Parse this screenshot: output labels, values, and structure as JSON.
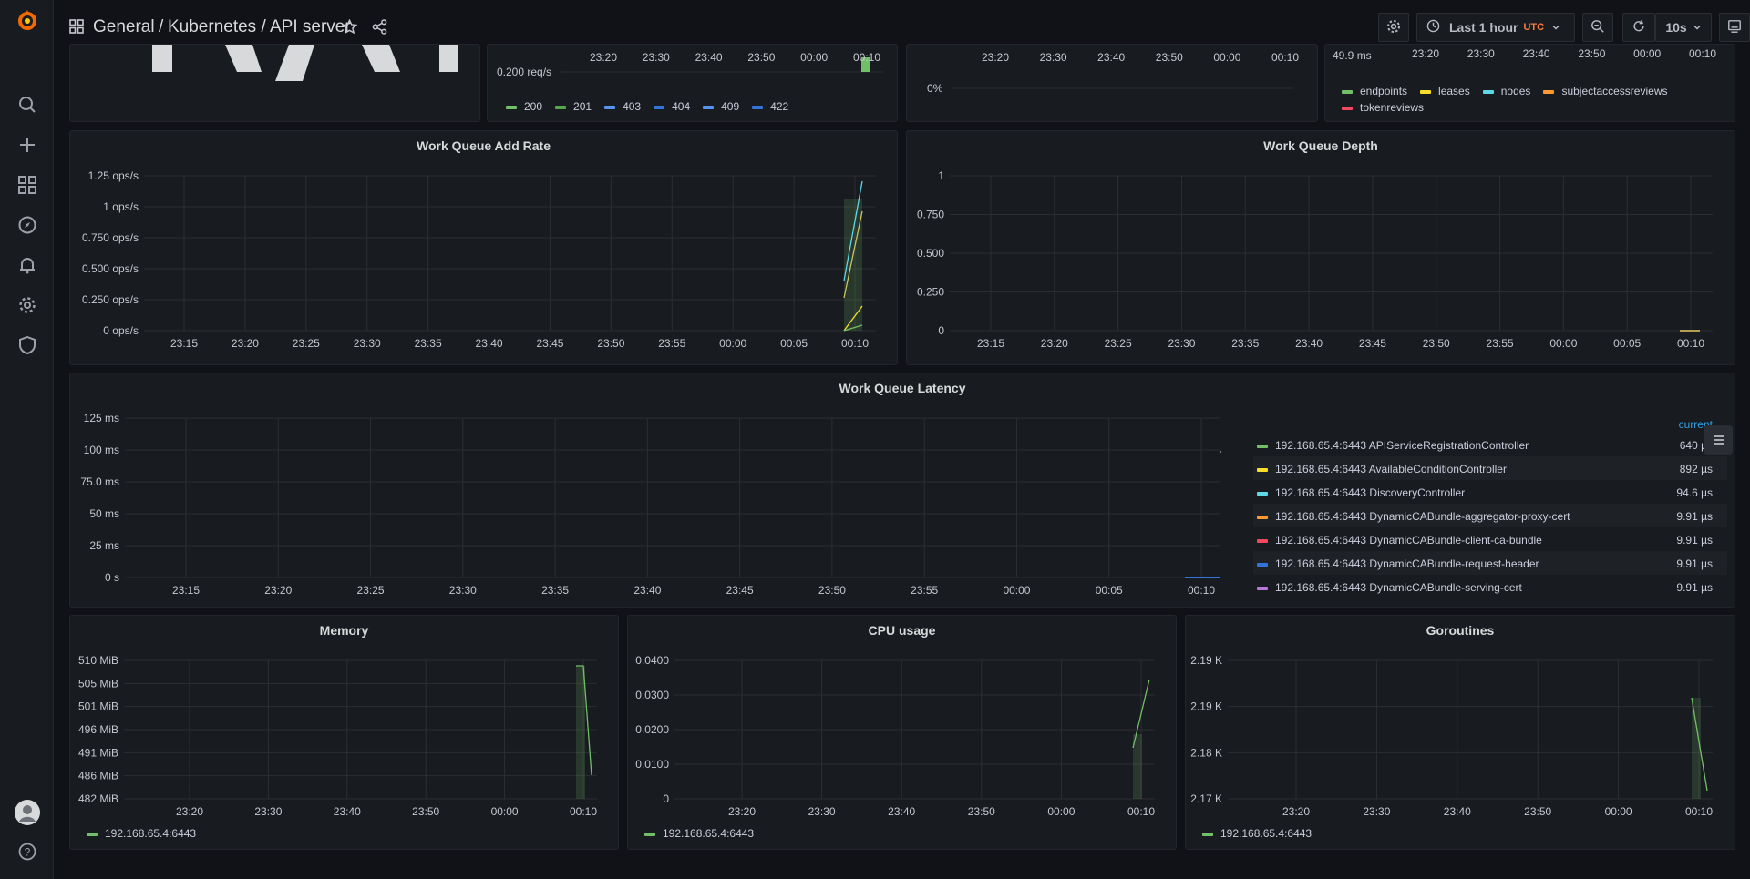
{
  "breadcrumb": {
    "folder": "General",
    "sep": "/",
    "path": "Kubernetes / API server"
  },
  "toolbar": {
    "time_range": "Last 1 hour",
    "tz": "UTC",
    "refresh": "10s"
  },
  "colors": {
    "green": "#73bf69",
    "yellow": "#fade2a",
    "blue": "#5794f2",
    "cyan": "#5ed8e6",
    "orange": "#ff9830",
    "red": "#f2495c",
    "purple": "#b877d9",
    "darkblue": "#3274d9",
    "axis_text": "#c7c8d0",
    "grid": "#2c2e33"
  },
  "panels": {
    "p_reqs": {
      "y_label": "0.200 req/s",
      "x_ticks": [
        "23:20",
        "23:30",
        "23:40",
        "23:50",
        "00:00",
        "00:10"
      ],
      "legend": [
        {
          "name": "200",
          "color": "#73bf69"
        },
        {
          "name": "201",
          "color": "#56a64b"
        },
        {
          "name": "403",
          "color": "#5794f2"
        },
        {
          "name": "404",
          "color": "#3274d9"
        },
        {
          "name": "409",
          "color": "#5794f2"
        },
        {
          "name": "422",
          "color": "#3274d9"
        }
      ]
    },
    "p_pct": {
      "y_label": "0%",
      "x_ticks": [
        "23:20",
        "23:30",
        "23:40",
        "23:50",
        "00:00",
        "00:10"
      ]
    },
    "p_ms": {
      "y_label": "49.9 ms",
      "x_ticks": [
        "23:20",
        "23:30",
        "23:40",
        "23:50",
        "00:00",
        "00:10"
      ],
      "legend": [
        {
          "name": "endpoints",
          "color": "#73bf69"
        },
        {
          "name": "leases",
          "color": "#fade2a"
        },
        {
          "name": "nodes",
          "color": "#5ed8e6"
        },
        {
          "name": "subjectaccessreviews",
          "color": "#ff9830"
        },
        {
          "name": "tokenreviews",
          "color": "#f2495c"
        }
      ]
    },
    "add_rate": {
      "title": "Work Queue Add Rate",
      "y_ticks": [
        "1.25 ops/s",
        "1 ops/s",
        "0.750 ops/s",
        "0.500 ops/s",
        "0.250 ops/s",
        "0 ops/s"
      ],
      "x_ticks": [
        "23:15",
        "23:20",
        "23:25",
        "23:30",
        "23:35",
        "23:40",
        "23:45",
        "23:50",
        "23:55",
        "00:00",
        "00:05",
        "00:10"
      ]
    },
    "depth": {
      "title": "Work Queue Depth",
      "y_ticks": [
        "1",
        "0.750",
        "0.500",
        "0.250",
        "0"
      ],
      "x_ticks": [
        "23:15",
        "23:20",
        "23:25",
        "23:30",
        "23:35",
        "23:40",
        "23:45",
        "23:50",
        "23:55",
        "00:00",
        "00:05",
        "00:10"
      ]
    },
    "latency": {
      "title": "Work Queue Latency",
      "y_ticks": [
        "125 ms",
        "100 ms",
        "75.0 ms",
        "50 ms",
        "25 ms",
        "0 s"
      ],
      "x_ticks": [
        "23:15",
        "23:20",
        "23:25",
        "23:30",
        "23:35",
        "23:40",
        "23:45",
        "23:50",
        "23:55",
        "00:00",
        "00:05",
        "00:10"
      ],
      "legend_header": "current",
      "legend": [
        {
          "name": "192.168.65.4:6443 APIServiceRegistrationController",
          "value": "640 µs",
          "color": "#73bf69"
        },
        {
          "name": "192.168.65.4:6443 AvailableConditionController",
          "value": "892 µs",
          "color": "#fade2a"
        },
        {
          "name": "192.168.65.4:6443 DiscoveryController",
          "value": "94.6 µs",
          "color": "#5ed8e6"
        },
        {
          "name": "192.168.65.4:6443 DynamicCABundle-aggregator-proxy-cert",
          "value": "9.91 µs",
          "color": "#ff9830"
        },
        {
          "name": "192.168.65.4:6443 DynamicCABundle-client-ca-bundle",
          "value": "9.91 µs",
          "color": "#f2495c"
        },
        {
          "name": "192.168.65.4:6443 DynamicCABundle-request-header",
          "value": "9.91 µs",
          "color": "#3274d9"
        },
        {
          "name": "192.168.65.4:6443 DynamicCABundle-serving-cert",
          "value": "9.91 µs",
          "color": "#b877d9"
        }
      ]
    },
    "memory": {
      "title": "Memory",
      "y_ticks": [
        "510 MiB",
        "505 MiB",
        "501 MiB",
        "496 MiB",
        "491 MiB",
        "486 MiB",
        "482 MiB"
      ],
      "x_ticks": [
        "23:20",
        "23:30",
        "23:40",
        "23:50",
        "00:00",
        "00:10"
      ],
      "legend": "192.168.65.4:6443"
    },
    "cpu": {
      "title": "CPU usage",
      "y_ticks": [
        "0.0400",
        "0.0300",
        "0.0200",
        "0.0100",
        "0"
      ],
      "x_ticks": [
        "23:20",
        "23:30",
        "23:40",
        "23:50",
        "00:00",
        "00:10"
      ],
      "legend": "192.168.65.4:6443"
    },
    "goroutines": {
      "title": "Goroutines",
      "y_ticks": [
        "2.19 K",
        "2.19 K",
        "2.18 K",
        "2.17 K"
      ],
      "x_ticks": [
        "23:20",
        "23:30",
        "23:40",
        "23:50",
        "00:00",
        "00:10"
      ],
      "legend": "192.168.65.4:6443"
    }
  }
}
